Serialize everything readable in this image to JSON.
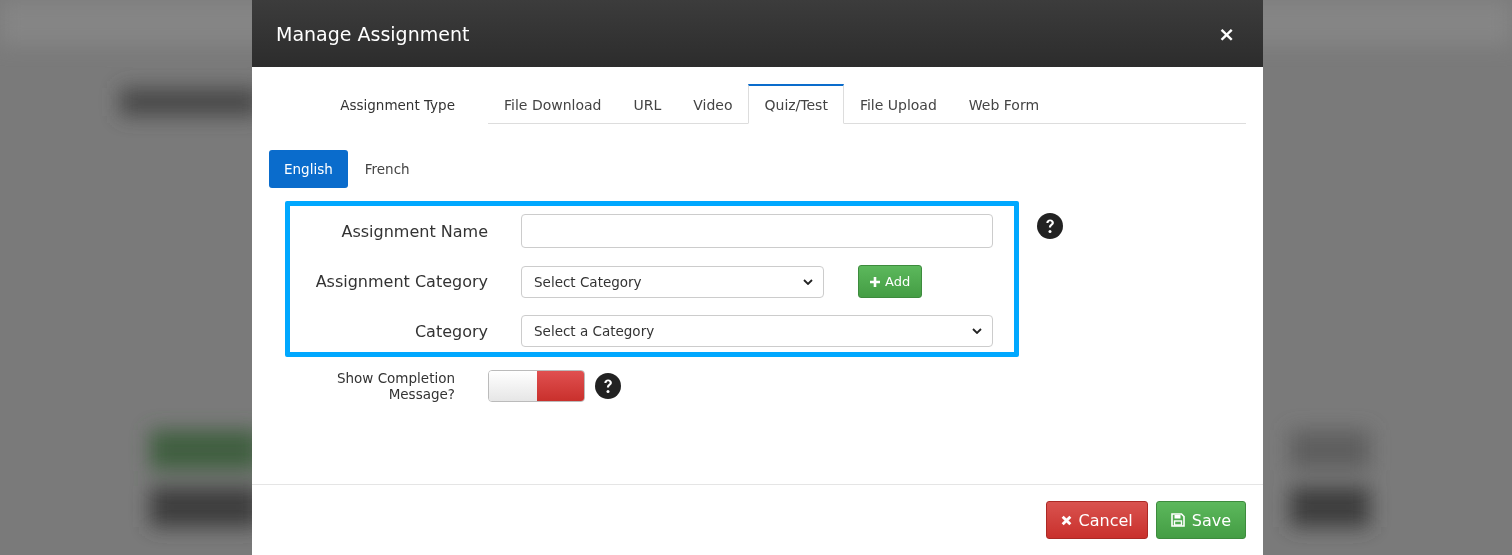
{
  "dialog": {
    "title": "Manage Assignment",
    "close": "×"
  },
  "assignment_type": {
    "label": "Assignment Type",
    "tabs": [
      {
        "label": "File Download",
        "selected": false
      },
      {
        "label": "URL",
        "selected": false
      },
      {
        "label": "Video",
        "selected": false
      },
      {
        "label": "Quiz/Test",
        "selected": true
      },
      {
        "label": "File Upload",
        "selected": false
      },
      {
        "label": "Web Form",
        "selected": false
      }
    ]
  },
  "languages": [
    {
      "label": "English",
      "selected": true
    },
    {
      "label": "French",
      "selected": false
    }
  ],
  "form": {
    "name_label": "Assignment Name",
    "category_label": "Assignment Category",
    "category_value": "Select Category",
    "add_button": "Add",
    "category2_label": "Category",
    "category2_value": "Select a Category"
  },
  "completion": {
    "label": "Show Completion Message?",
    "on": false
  },
  "buttons": {
    "cancel": "Cancel",
    "save": "Save"
  }
}
